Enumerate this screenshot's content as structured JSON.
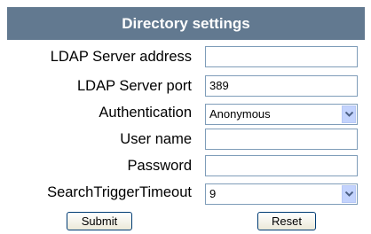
{
  "title": "Directory settings",
  "fields": [
    {
      "label": "LDAP Server address",
      "value": ""
    },
    {
      "label": "LDAP Server port",
      "value": "389"
    },
    {
      "label": "Authentication",
      "value": "Anonymous"
    },
    {
      "label": "User name",
      "value": ""
    },
    {
      "label": "Password",
      "value": ""
    },
    {
      "label": "SearchTriggerTimeout",
      "value": "9"
    }
  ],
  "buttons": {
    "submit": "Submit",
    "reset": "Reset"
  },
  "colors": {
    "header": "#627990",
    "panel": "#b3c6d6",
    "field_border": "#7f9db9",
    "dropdown_button": "#c3d3fd",
    "dropdown_arrow": "#4d6185"
  }
}
